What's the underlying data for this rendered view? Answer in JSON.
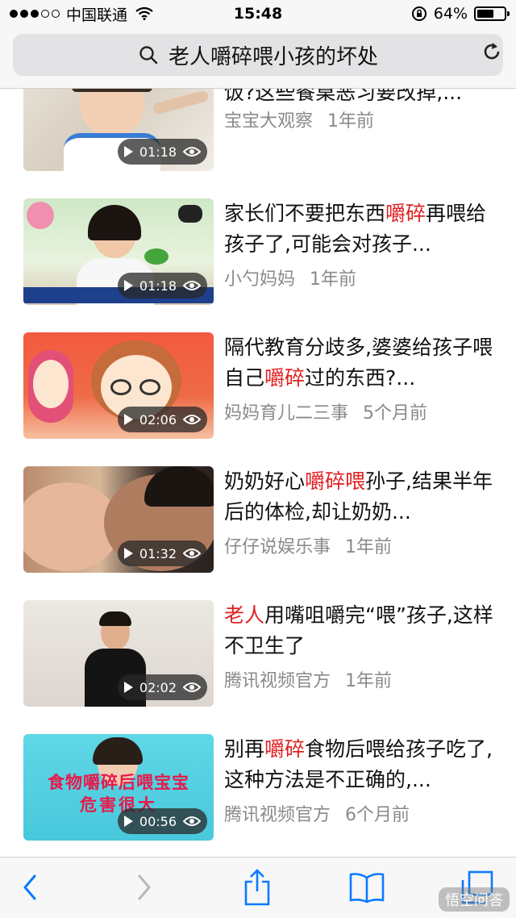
{
  "status_bar": {
    "carrier": "中国联通",
    "time": "15:48",
    "battery": "64%",
    "battery_level": 0.64
  },
  "address_bar": {
    "query": "老人嚼碎喂小孩的坏处"
  },
  "videos": [
    {
      "title_segments": [
        {
          "text": "饭?这些餐桌恶习要改掉,...",
          "hl": false
        }
      ],
      "source": "宝宝大观察",
      "age": "1年前",
      "duration": "01:18"
    },
    {
      "title_segments": [
        {
          "text": "家长们不要把东西",
          "hl": false
        },
        {
          "text": "嚼碎",
          "hl": true
        },
        {
          "text": "再喂给孩子了,可能会对孩子...",
          "hl": false
        }
      ],
      "source": "小勺妈妈",
      "age": "1年前",
      "duration": "01:18"
    },
    {
      "title_segments": [
        {
          "text": "隔代教育分歧多,婆婆给孩子喂自己",
          "hl": false
        },
        {
          "text": "嚼碎",
          "hl": true
        },
        {
          "text": "过的东西?...",
          "hl": false
        }
      ],
      "source": "妈妈育儿二三事",
      "age": "5个月前",
      "duration": "02:06"
    },
    {
      "title_segments": [
        {
          "text": "奶奶好心",
          "hl": false
        },
        {
          "text": "嚼碎喂",
          "hl": true
        },
        {
          "text": "孙子,结果半年后的体检,却让奶奶...",
          "hl": false
        }
      ],
      "source": "仔仔说娱乐事",
      "age": "1年前",
      "duration": "01:32"
    },
    {
      "title_segments": [
        {
          "text": "老人",
          "hl": true
        },
        {
          "text": "用嘴咀嚼完“喂”孩子,这样不卫生了",
          "hl": false
        }
      ],
      "source": "腾讯视频官方",
      "age": "1年前",
      "duration": "02:02"
    },
    {
      "title_segments": [
        {
          "text": "别再",
          "hl": false
        },
        {
          "text": "嚼碎",
          "hl": true
        },
        {
          "text": "食物后喂给孩子吃了,这种方法是不正确的,...",
          "hl": false
        }
      ],
      "source": "腾讯视频官方",
      "age": "6个月前",
      "duration": "00:56"
    }
  ],
  "thumb_texts": {
    "video6_line1": "食物嚼碎后喂宝宝",
    "video6_line2": "危害很大"
  },
  "toolbar": {
    "back_icon": "chevron-left-icon",
    "forward_icon": "chevron-right-icon",
    "share_icon": "share-icon",
    "bookmarks_icon": "book-icon",
    "tabs_icon": "tabs-icon"
  },
  "watermark": "悟空问答",
  "colors": {
    "highlight": "#e02020",
    "meta": "#8a8a8a",
    "accent": "#0a7aff"
  }
}
